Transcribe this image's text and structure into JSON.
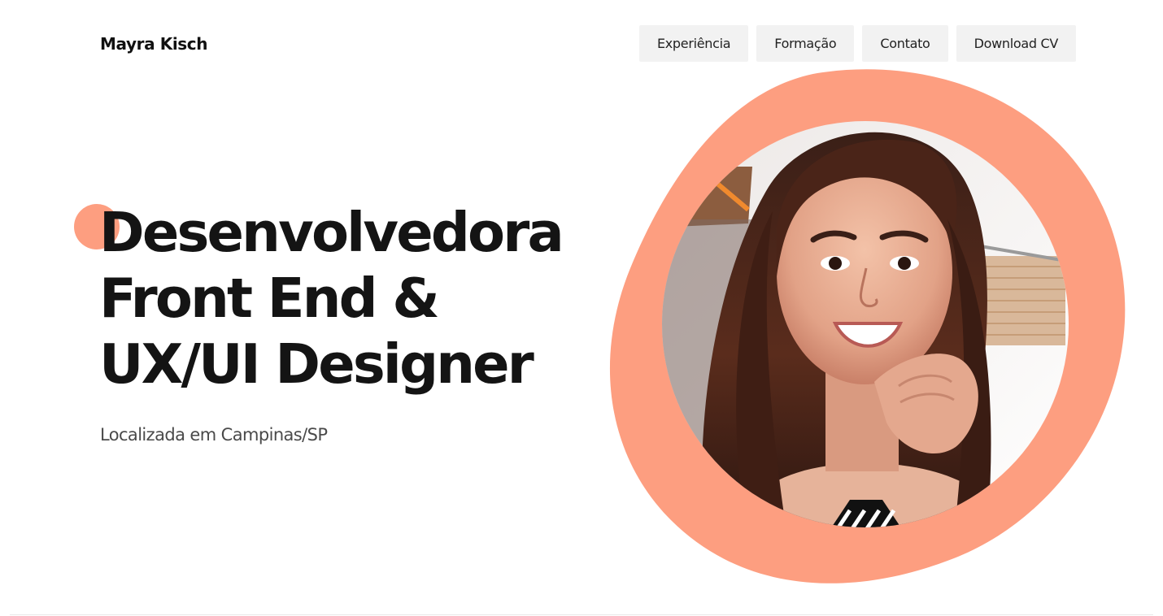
{
  "header": {
    "brand": "Mayra Kisch",
    "nav": [
      {
        "label": "Experiência"
      },
      {
        "label": "Formação"
      },
      {
        "label": "Contato"
      },
      {
        "label": "Download CV"
      }
    ]
  },
  "hero": {
    "headline": [
      "Desenvolvedora",
      "Front End &",
      "UX/UI Designer"
    ],
    "location": "Localizada em Campinas/SP",
    "photo_icon": "profile-photo"
  },
  "colors": {
    "accent": "#fd9e80",
    "text": "#141414",
    "muted": "#4a4a4a",
    "nav_bg": "#f2f2f2"
  }
}
